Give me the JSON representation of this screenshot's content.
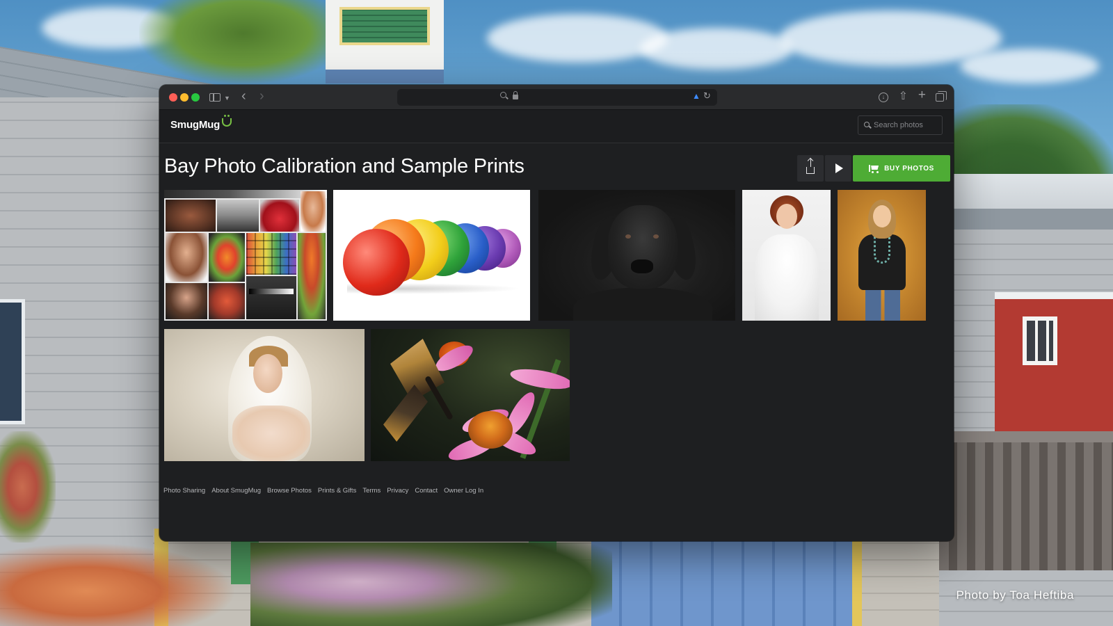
{
  "wallpaper": {
    "credit": "Photo by Toa Heftiba"
  },
  "browser": {
    "controls": [
      "close",
      "minimize",
      "zoom"
    ],
    "toolbar_icons": [
      "sidebar-icon",
      "chevron-down-icon",
      "back-icon",
      "forward-icon",
      "search-icon",
      "lock-icon",
      "speaker-icon",
      "reload-icon",
      "download-icon",
      "share-icon",
      "plus-icon",
      "tabs-icon"
    ]
  },
  "site": {
    "logo": "SmugMug",
    "search_placeholder": "Search photos",
    "brand_color": "#4eac35"
  },
  "gallery": {
    "title": "Bay Photo Calibration and Sample Prints",
    "buy_label": "BUY PHOTOS",
    "thumbnails": [
      "calibration-collage",
      "rainbow-balls",
      "black-labrador",
      "bride-white-dress",
      "girl-autumn-leaves",
      "veiled-woman",
      "butterfly-coneflower"
    ]
  },
  "footer": {
    "links": [
      "Photo Sharing",
      "About SmugMug",
      "Browse Photos",
      "Prints & Gifts",
      "Terms",
      "Privacy",
      "Contact",
      "Owner Log In"
    ]
  }
}
